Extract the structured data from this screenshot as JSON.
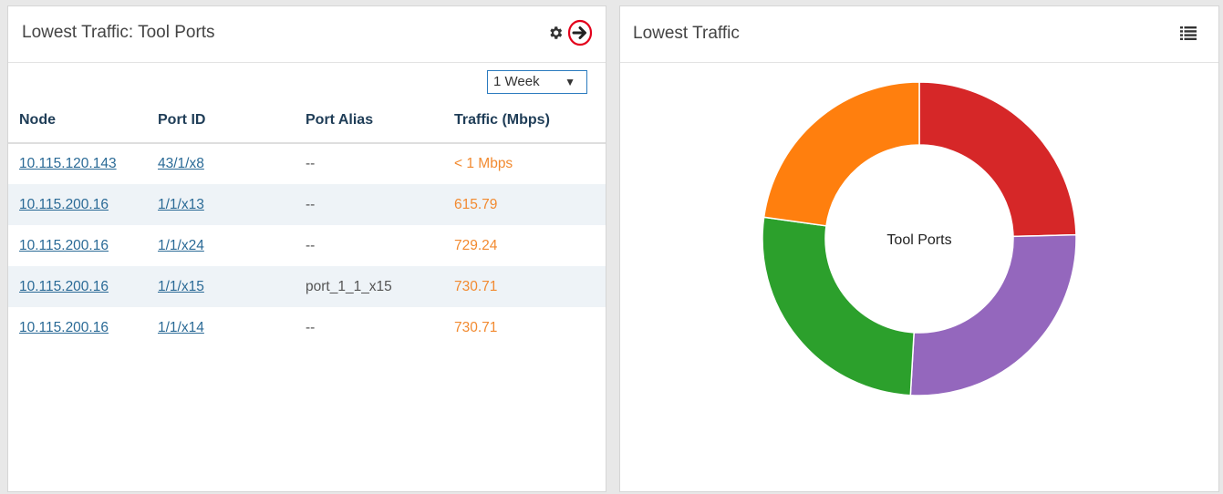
{
  "left_panel": {
    "title": "Lowest Traffic: Tool Ports",
    "range": "1 Week",
    "columns": [
      "Node",
      "Port ID",
      "Port Alias",
      "Traffic (Mbps)"
    ],
    "rows": [
      {
        "node": "10.115.120.143",
        "port": "43/1/x8",
        "alias": "--",
        "traffic": "< 1 Mbps"
      },
      {
        "node": "10.115.200.16",
        "port": "1/1/x13",
        "alias": "--",
        "traffic": "615.79"
      },
      {
        "node": "10.115.200.16",
        "port": "1/1/x24",
        "alias": "--",
        "traffic": "729.24"
      },
      {
        "node": "10.115.200.16",
        "port": "1/1/x15",
        "alias": "port_1_1_x15",
        "traffic": "730.71"
      },
      {
        "node": "10.115.200.16",
        "port": "1/1/x14",
        "alias": "--",
        "traffic": "730.71"
      }
    ]
  },
  "right_panel": {
    "title": "Lowest Traffic",
    "center_label": "Tool Ports"
  },
  "chart_data": {
    "type": "pie",
    "donut": true,
    "center_label": "Tool Ports",
    "values": [
      615.79,
      729.24,
      730.71,
      730.71,
      0
    ],
    "colors": [
      "#d62728",
      "#9467bd",
      "#2ca02c",
      "#ff7f0e"
    ],
    "chart_values_shown": [
      24.6,
      26.3,
      26.3,
      22.8
    ]
  },
  "colors": {
    "link": "#2a6a96",
    "traffic": "#f28a30",
    "header_text": "#1f3d57",
    "alt_row": "#eef3f7",
    "highlight_circle": "#e3001b"
  }
}
